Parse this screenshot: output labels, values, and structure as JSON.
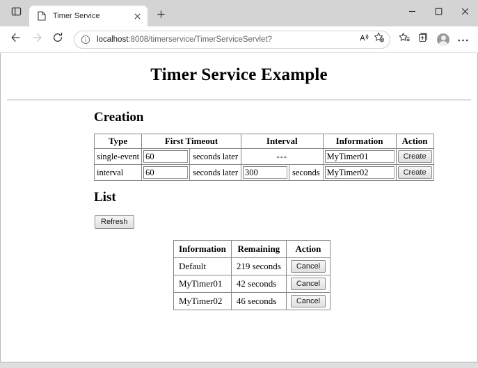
{
  "browser": {
    "tab_search_icon": "tab-search-icon",
    "tab": {
      "favicon": "page-icon",
      "title": "Timer Service",
      "close_icon": "close-icon"
    },
    "new_tab_icon": "plus-icon",
    "window_controls": {
      "minimize": "minimize-icon",
      "maximize": "maximize-icon",
      "close": "close-icon"
    },
    "nav": {
      "back_icon": "back-arrow-icon",
      "forward_icon": "forward-arrow-icon",
      "refresh_icon": "reload-icon"
    },
    "omnibox": {
      "info_icon": "info-circle-icon",
      "url_host": "localhost",
      "url_path": ":8008/timerservice/TimerServiceServlet?",
      "read_aloud_icon": "read-aloud-icon",
      "add_favorite_icon": "add-favorite-star-icon"
    },
    "toolbar": {
      "favorites_icon": "favorites-star-icon",
      "collections_icon": "collections-icon",
      "profile_icon": "profile-avatar-icon",
      "settings_icon": "more-options-icon"
    }
  },
  "page": {
    "title": "Timer Service Example",
    "sections": {
      "creation": {
        "heading": "Creation",
        "columns": [
          "Type",
          "First Timeout",
          "Interval",
          "Information",
          "Action"
        ],
        "rows": [
          {
            "type": "single-event",
            "first_timeout_value": "60",
            "first_timeout_label": "seconds later",
            "interval_value": null,
            "interval_placeholder_text": "---",
            "interval_label": "",
            "information_value": "MyTimer01",
            "action_label": "Create"
          },
          {
            "type": "interval",
            "first_timeout_value": "60",
            "first_timeout_label": "seconds later",
            "interval_value": "300",
            "interval_placeholder_text": "",
            "interval_label": "seconds",
            "information_value": "MyTimer02",
            "action_label": "Create"
          }
        ]
      },
      "list": {
        "heading": "List",
        "refresh_label": "Refresh",
        "columns": [
          "Information",
          "Remaining",
          "Action"
        ],
        "rows": [
          {
            "information": "Default",
            "remaining": "219 seconds",
            "action_label": "Cancel"
          },
          {
            "information": "MyTimer01",
            "remaining": "42 seconds",
            "action_label": "Cancel"
          },
          {
            "information": "MyTimer02",
            "remaining": "46 seconds",
            "action_label": "Cancel"
          }
        ]
      }
    }
  },
  "colors": {
    "tab_strip_bg": "#d4d4d4",
    "page_bg": "#ffffff",
    "text": "#000000",
    "url_host_text": "#1b1b1b",
    "url_path_text": "#656565",
    "table_border": "#888888",
    "button_bg": "#e9e9e9"
  }
}
